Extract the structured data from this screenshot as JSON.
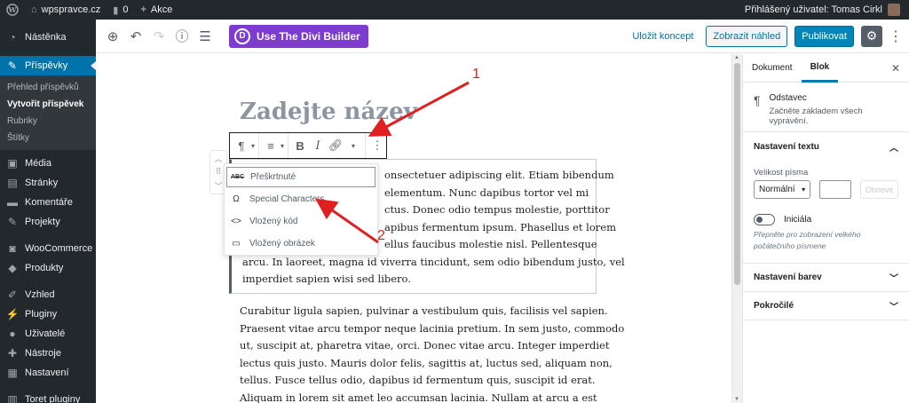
{
  "adminbar": {
    "site_name": "wpspravce.cz",
    "comments_count": "0",
    "new_label": "Akce",
    "user_greeting": "Přihlášený uživatel: Tomas Cirkl"
  },
  "sidebar": {
    "items": [
      {
        "label": "Nástěnka",
        "icon": "dashboard-icon"
      },
      {
        "label": "Příspěvky",
        "icon": "pin-icon"
      },
      {
        "label": "Média",
        "icon": "media-icon"
      },
      {
        "label": "Stránky",
        "icon": "pages-icon"
      },
      {
        "label": "Komentáře",
        "icon": "comments-icon"
      },
      {
        "label": "Projekty",
        "icon": "pin-icon"
      },
      {
        "label": "WooCommerce",
        "icon": "woocommerce-icon"
      },
      {
        "label": "Produkty",
        "icon": "products-icon"
      },
      {
        "label": "Vzhled",
        "icon": "brush-icon"
      },
      {
        "label": "Pluginy",
        "icon": "plugin-icon"
      },
      {
        "label": "Uživatelé",
        "icon": "users-icon"
      },
      {
        "label": "Nástroje",
        "icon": "wrench-icon"
      },
      {
        "label": "Nastavení",
        "icon": "settings-icon"
      },
      {
        "label": "Toret pluginy",
        "icon": "plugin-icon"
      }
    ],
    "submenu": [
      "Přehled příspěvků",
      "Vytvořit příspěvek",
      "Rubriky",
      "Štítky"
    ]
  },
  "header": {
    "divi_label": "Use The Divi Builder",
    "save_draft": "Uložit koncept",
    "preview": "Zobrazit náhled",
    "publish": "Publikovat"
  },
  "editor": {
    "title_placeholder": "Zadejte název",
    "dropdown": [
      {
        "label": "Přeškrtnuté",
        "icon": "abc"
      },
      {
        "label": "Special Characters",
        "icon": "Ω"
      },
      {
        "label": "Vložený kód",
        "icon": "<>"
      },
      {
        "label": "Vložený obrázek",
        "icon": "▭"
      }
    ],
    "p1_lines": [
      "onsectetuer adipiscing elit. Etiam bibendum",
      "elementum. Nunc dapibus tortor vel mi",
      "ctus. Donec odio tempus molestie, porttitor",
      "apibus fermentum ipsum. Phasellus et lorem",
      "ellus faucibus molestie nisl. Pellentesque",
      "arcu. In laoreet, magna id viverra tincidunt, sem odio bibendum justo, vel",
      "imperdiet sapien wisi sed libero."
    ],
    "p2_lines": [
      "Curabitur ligula sapien, pulvinar a vestibulum quis, facilisis vel sapien.",
      "Praesent vitae arcu tempor neque lacinia pretium. In sem justo, commodo",
      "ut, suscipit at, pharetra vitae, orci. Donec vitae arcu. Integer imperdiet",
      "lectus quis justo. Mauris dolor felis, sagittis at, luctus sed, aliquam non,",
      "tellus. Fusce tellus odio, dapibus id fermentum quis, suscipit id erat.",
      "Aliquam in lorem sit amet leo accumsan lacinia. Nullam at arcu a est"
    ],
    "annotation_1": "1",
    "annotation_2": "2"
  },
  "panel": {
    "tab_document": "Dokument",
    "tab_block": "Blok",
    "block_name": "Odstavec",
    "block_desc": "Začněte základem všech vyprávění.",
    "text_settings": "Nastavení textu",
    "font_size_label": "Velikost písma",
    "font_size_value": "Normální",
    "reset": "Obnovit",
    "dropcap_label": "Iniciála",
    "dropcap_help": "Přepněte pro zobrazení velkého počátečního písmene",
    "color_settings": "Nastavení barev",
    "advanced": "Pokročilé"
  },
  "colors": {
    "admin_dark": "#23282d",
    "wp_blue": "#0073aa",
    "divi_purple": "#7e3bd0",
    "annotation_red": "#e02020"
  }
}
